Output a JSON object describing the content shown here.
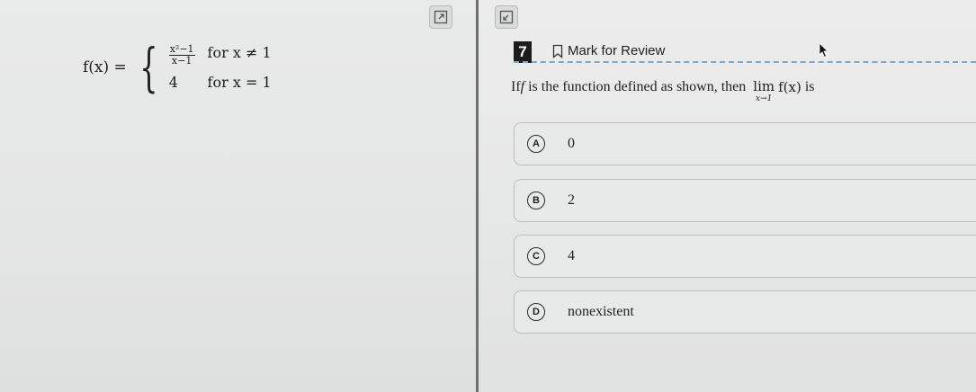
{
  "question": {
    "number": "7",
    "mark_label": "Mark for Review",
    "text_before": "If ",
    "function_name": "f",
    "text_mid": " is the function defined as shown, then ",
    "lim_word": "lim",
    "lim_sub": "x→1",
    "lim_expr": "f(x)",
    "text_after": " is"
  },
  "equation": {
    "lhs": "f(x) =",
    "case1_num": "x²−1",
    "case1_den": "x−1",
    "case1_cond": "for x ≠ 1",
    "case2_val": "4",
    "case2_cond": "for x = 1"
  },
  "choices": [
    {
      "letter": "A",
      "text": "0"
    },
    {
      "letter": "B",
      "text": "2"
    },
    {
      "letter": "C",
      "text": "4"
    },
    {
      "letter": "D",
      "text": "nonexistent"
    }
  ],
  "colors": {
    "accent_dash": "#7fa7c9",
    "number_bg": "#1c1c1c"
  },
  "icons": [
    "expand-icon",
    "collapse-icon",
    "bookmark-icon",
    "cursor-icon"
  ]
}
